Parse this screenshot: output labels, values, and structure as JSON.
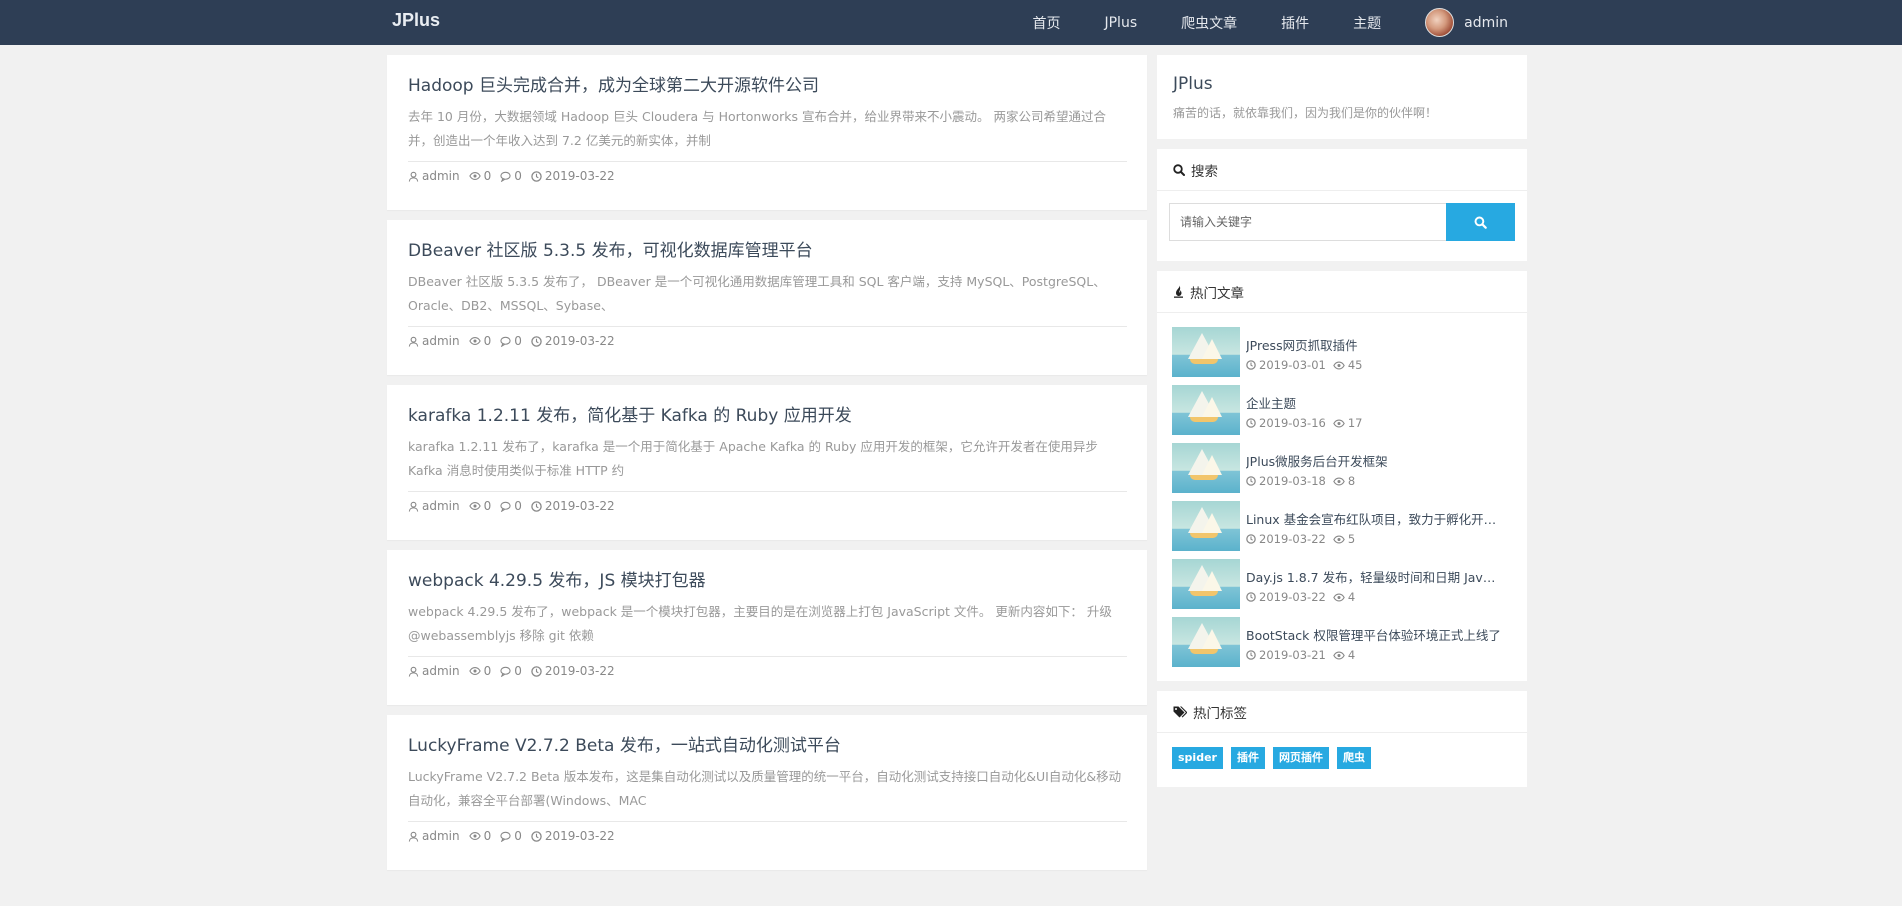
{
  "navbar": {
    "brand": "JPlus",
    "items": [
      {
        "label": "首页"
      },
      {
        "label": "JPlus"
      },
      {
        "label": "爬虫文章"
      },
      {
        "label": "插件"
      },
      {
        "label": "主题"
      }
    ],
    "user": "admin"
  },
  "articles": [
    {
      "title": "Hadoop 巨头完成合并，成为全球第二大开源软件公司",
      "summary": "去年 10 月份，大数据领域 Hadoop 巨头 Cloudera 与 Hortonworks 宣布合并，给业界带来不小震动。 两家公司希望通过合并，创造出一个年收入达到 7.2 亿美元的新实体，并制",
      "author": "admin",
      "views": "0",
      "comments": "0",
      "date": "2019-03-22"
    },
    {
      "title": "DBeaver 社区版 5.3.5 发布，可视化数据库管理平台",
      "summary": "DBeaver 社区版 5.3.5 发布了， DBeaver 是一个可视化通用数据库管理工具和 SQL 客户端，支持 MySQL、PostgreSQL、Oracle、DB2、MSSQL、Sybase、",
      "author": "admin",
      "views": "0",
      "comments": "0",
      "date": "2019-03-22"
    },
    {
      "title": "karafka 1.2.11 发布，简化基于 Kafka 的 Ruby 应用开发",
      "summary": "karafka 1.2.11 发布了，karafka 是一个用于简化基于 Apache Kafka 的 Ruby 应用开发的框架，它允许开发者在使用异步 Kafka 消息时使用类似于标准 HTTP 约",
      "author": "admin",
      "views": "0",
      "comments": "0",
      "date": "2019-03-22"
    },
    {
      "title": "webpack 4.29.5 发布，JS 模块打包器",
      "summary": "webpack 4.29.5 发布了，webpack 是一个模块打包器，主要目的是在浏览器上打包 JavaScript 文件。 更新内容如下： 升级 @webassemblyjs 移除 git 依赖",
      "author": "admin",
      "views": "0",
      "comments": "0",
      "date": "2019-03-22"
    },
    {
      "title": "LuckyFrame V2.7.2 Beta 发布，一站式自动化测试平台",
      "summary": "LuckyFrame V2.7.2 Beta 版本发布，这是集自动化测试以及质量管理的统一平台，自动化测试支持接口自动化&UI自动化&移动自动化，兼容全平台部署(Windows、MAC",
      "author": "admin",
      "views": "0",
      "comments": "0",
      "date": "2019-03-22"
    }
  ],
  "sidebar": {
    "site": {
      "title": "JPlus",
      "desc": "痛苦的话，就依靠我们，因为我们是你的伙伴啊！"
    },
    "search": {
      "header": "搜索",
      "placeholder": "请输入关键字"
    },
    "hot": {
      "header": "热门文章",
      "items": [
        {
          "title": "JPress网页抓取插件",
          "date": "2019-03-01",
          "views": "45"
        },
        {
          "title": "企业主题",
          "date": "2019-03-16",
          "views": "17"
        },
        {
          "title": "JPlus微服务后台开发框架",
          "date": "2019-03-18",
          "views": "8"
        },
        {
          "title": "Linux 基金会宣布红队项目，致力于孵化开…",
          "date": "2019-03-22",
          "views": "5"
        },
        {
          "title": "Day.js 1.8.7 发布，轻量级时间和日期 Java…",
          "date": "2019-03-22",
          "views": "4"
        },
        {
          "title": "BootStack 权限管理平台体验环境正式上线了",
          "date": "2019-03-21",
          "views": "4"
        }
      ]
    },
    "tags": {
      "header": "热门标签",
      "items": [
        {
          "label": "spider"
        },
        {
          "label": "插件"
        },
        {
          "label": "网页插件"
        },
        {
          "label": "爬虫"
        }
      ]
    }
  },
  "colors": {
    "navbar": "#2e3e55",
    "accent": "#27a9e1",
    "background": "#f1f1f1"
  }
}
